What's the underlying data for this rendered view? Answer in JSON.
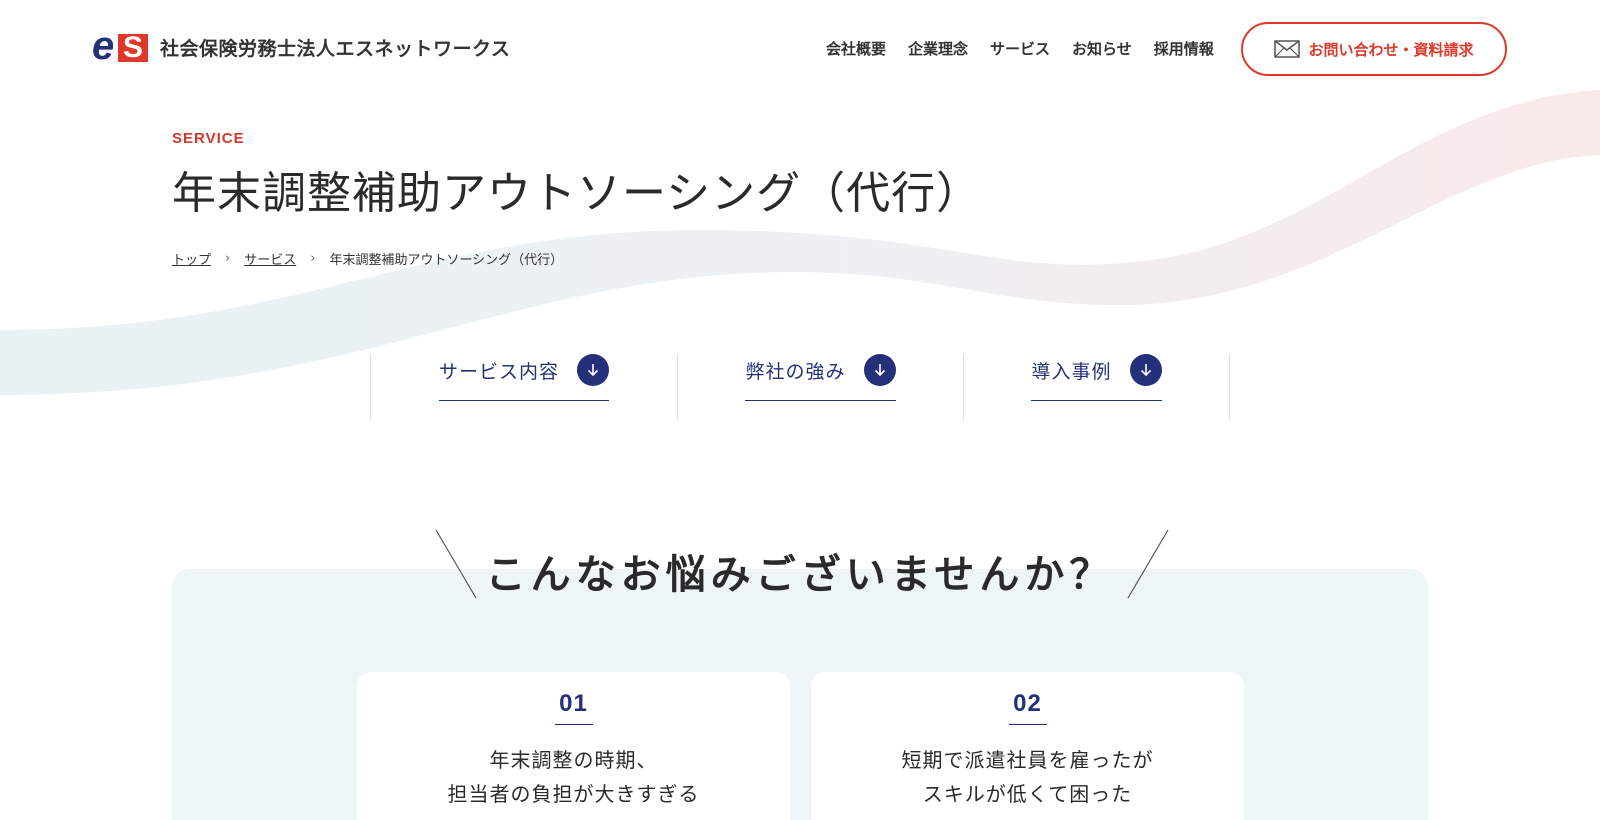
{
  "brand": {
    "logo_e": "e",
    "logo_s": "S",
    "name": "社会保険労務士法人エスネットワークス"
  },
  "nav": {
    "items": [
      "会社概要",
      "企業理念",
      "サービス",
      "お知らせ",
      "採用情報"
    ],
    "contact_label": "お問い合わせ・資料請求"
  },
  "hero": {
    "eyebrow": "SERVICE",
    "title": "年末調整補助アウトソーシング（代行）",
    "breadcrumb": [
      "トップ",
      "サービス",
      "年末調整補助アウトソーシング（代行）"
    ],
    "breadcrumb_sep": "›"
  },
  "anchors": [
    "サービス内容",
    "弊社の強み",
    "導入事例"
  ],
  "trouble": {
    "title": "こんなお悩みございませんか？",
    "cards": [
      {
        "num": "01",
        "lines": [
          "年末調整の時期、",
          "担当者の負担が大きすぎる"
        ]
      },
      {
        "num": "02",
        "lines": [
          "短期で派遣社員を雇ったが",
          "スキルが低くて困った"
        ]
      }
    ]
  },
  "colors": {
    "accent_red": "#e0392b",
    "navy": "#25307a",
    "section_bg": "#eef5f7"
  },
  "icons": [
    "mail-icon",
    "arrow-down-icon"
  ]
}
